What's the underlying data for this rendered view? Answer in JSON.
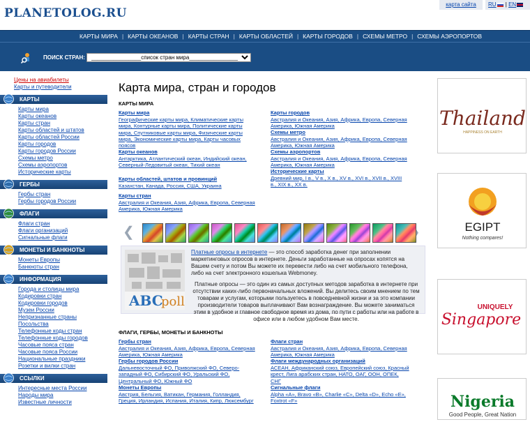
{
  "header": {
    "logo": "PLANETOLOG.RU",
    "sitemap": "карта сайта",
    "lang_ru": "RU",
    "lang_en": "EN"
  },
  "topnav": [
    "КАРТЫ МИРА",
    "КАРТЫ ОКЕАНОВ",
    "КАРТЫ СТРАН",
    "КАРТЫ ОБЛАСТЕЙ",
    "КАРТЫ ГОРОДОВ",
    "СХЕМЫ МЕТРО",
    "СХЕМЫ АЭРОПОРТОВ"
  ],
  "search": {
    "label": "ПОИСК СТРАН:",
    "selected": "________________список стран мира________________"
  },
  "sidebar": {
    "top_links": [
      "Цены на авиабилеты",
      "Карты и путеводители"
    ],
    "sections": [
      {
        "title": "КАРТЫ",
        "icon": "globe-icon",
        "items": [
          "Карты мира",
          "Карты океанов",
          "Карты стран",
          "Карты областей и штатов",
          "Карты областей России",
          "Карты городов",
          "Карты городов России",
          "Схемы метро",
          "Схемы аэропортов",
          "Исторические карты"
        ]
      },
      {
        "title": "ГЕРБЫ",
        "icon": "shield-icon",
        "items": [
          "Гербы стран",
          "Гербы городов России"
        ]
      },
      {
        "title": "ФЛАГИ",
        "icon": "flag-icon",
        "items": [
          "Флаги стран",
          "Флаги организаций",
          "Сигнальные флаги"
        ]
      },
      {
        "title": "МОНЕТЫ И БАНКНОТЫ",
        "icon": "coins-icon",
        "items": [
          "Монеты Европы",
          "Банкноты стран"
        ]
      },
      {
        "title": "ИНФОРМАЦИЯ",
        "icon": "info-globe-icon",
        "items": [
          "Города и столицы мира",
          "Кодировки стран",
          "Кодировки городов",
          "Музеи России",
          "Непризнанные страны",
          "Посольства",
          "Телефонные коды стран",
          "Телефонные коды городов",
          "Часовые пояса стран",
          "Часовые пояса России",
          "Национальные праздники",
          "Розетки и вилки стран"
        ]
      },
      {
        "title": "ССЫЛКИ",
        "icon": "links-globe-icon",
        "items": [
          "Интересные места России",
          "Народы мира",
          "Известные личности"
        ]
      }
    ]
  },
  "main": {
    "title": "Карта мира, стран и городов",
    "maps_heading": "КАРТЫ МИРА",
    "left_blocks": [
      {
        "h": "Карты мира",
        "lines": [
          "Географические карты мира, Климатические карты",
          "мира, Контурные карты мира, Политические карты",
          "мира, Спутниковые карты мира, Физические карты",
          "мира, Экономические карты мира, Карты часовых",
          "поясов"
        ]
      },
      {
        "h": "Карты океанов",
        "lines": [
          "Антарктика, Атлантический океан, Индийский океан,",
          "Северный-Ледовитый океан, Тихий океан"
        ]
      },
      {
        "h": "Карты областей, штатов и провинций",
        "lines": [
          "Казахстан, Канада, Россия, США, Украина"
        ]
      },
      {
        "h": "Карты стран",
        "lines": [
          "Австралия и Океания, Азия, Африка, Европа, Северная",
          "Америка, Южная Америка"
        ]
      }
    ],
    "right_blocks": [
      {
        "h": "Карты городов",
        "lines": [
          "Австралия и Океания, Азия, Африка, Европа, Северная",
          "Америка, Южная Америка"
        ]
      },
      {
        "h": "Схемы метро",
        "lines": [
          "Австралия и Океания, Азия, Африка, Европа, Северная",
          "Америка, Южная Америка"
        ]
      },
      {
        "h": "Схемы аэропортов",
        "lines": [
          "Австралия и Океания, Азия, Африка, Европа, Северная",
          "Америка, Южная Америка"
        ]
      },
      {
        "h": "Исторические карты",
        "lines": [
          "Древний мир, I в., V в., X в., XV в., XVI в., XVII в., XVIII",
          "в., XIX в., XX в."
        ]
      }
    ],
    "ad": {
      "p1_link": "Платные опросы в интернете",
      "p1": " — это способ заработка денег при заполнении маркетинговых опросов в интернете. Деньги заработанные на опросах копятся на Вашем счету и потом Вы можете их перевести либо на счет мобильного телефона, либо на счет электронного кошелька Webmoney.",
      "p2": "Платные опросы — это один из самых доступных методов заработка в интернете при отсутствии каких-либо первоначальных вложений. Вы делитесь своим мнением по тем товарам и услугам, которыми пользуетесь в повседневной жизни и за это компании производители товаров выплачивают Вам вознаграждение. Вы можете заниматься этим в удобное и главное свободное время из дома, по пути с работы или на работе в офисе или в любом удобном Вам месте.",
      "logo": "ABCpoll"
    },
    "flags_heading": "ФЛАГИ, ГЕРБЫ, МОНЕТЫ И БАНКНОТЫ",
    "flags_left": [
      {
        "h": "Гербы стран",
        "lines": [
          "Австралия и Океания, Азия, Африка, Европа, Северная",
          "Америка, Южная Америка"
        ]
      },
      {
        "h": "Гербы городов России",
        "lines": [
          "Дальневосточный ФО, Приволжский ФО, Северо-",
          "западный ФО, Сибирский ФО, Уральский ФО,",
          "Центральный ФО, Южный ФО"
        ]
      },
      {
        "h": "Монеты Европы",
        "lines": [
          "Австрия, Бельгия, Ватикан, Германия, Голландия,",
          "Греция, Ирландия, Испания, Италия, Кипр, Люксембург"
        ]
      }
    ],
    "flags_right": [
      {
        "h": "Флаги стран",
        "lines": [
          "Австралия и Океания, Азия, Африка, Европа, Северная",
          "Америка, Южная Америка"
        ]
      },
      {
        "h": "Флаги международных организаций",
        "lines": [
          "АСЕАН, Африканский союз, Европейский союз, Красный",
          "крест, Лига арабских стран, НАТО, ОАГ, ООН, ОПЕК,",
          "СНГ"
        ]
      },
      {
        "h": "Сигнальные флаги",
        "lines": [
          "Alpha «A», Bravo «B», Charlie «C», Delta «D», Echo «E»,",
          "Foxtrot «F»"
        ]
      }
    ]
  },
  "banners": [
    {
      "name": "thailand",
      "text": "Thailand",
      "sub": "HAPPINESS ON EARTH"
    },
    {
      "name": "egypt",
      "text": "EGIPT",
      "sub": "Nothing compares!"
    },
    {
      "name": "singapore",
      "text": "Singapore",
      "sub": "UNIQUELY"
    },
    {
      "name": "nigeria",
      "text": "Nigeria",
      "sub": "Good People, Great Nation"
    }
  ],
  "colors": {
    "nav": "#1a4d84",
    "link": "#0645ad",
    "logo": "#1b4f8f"
  }
}
